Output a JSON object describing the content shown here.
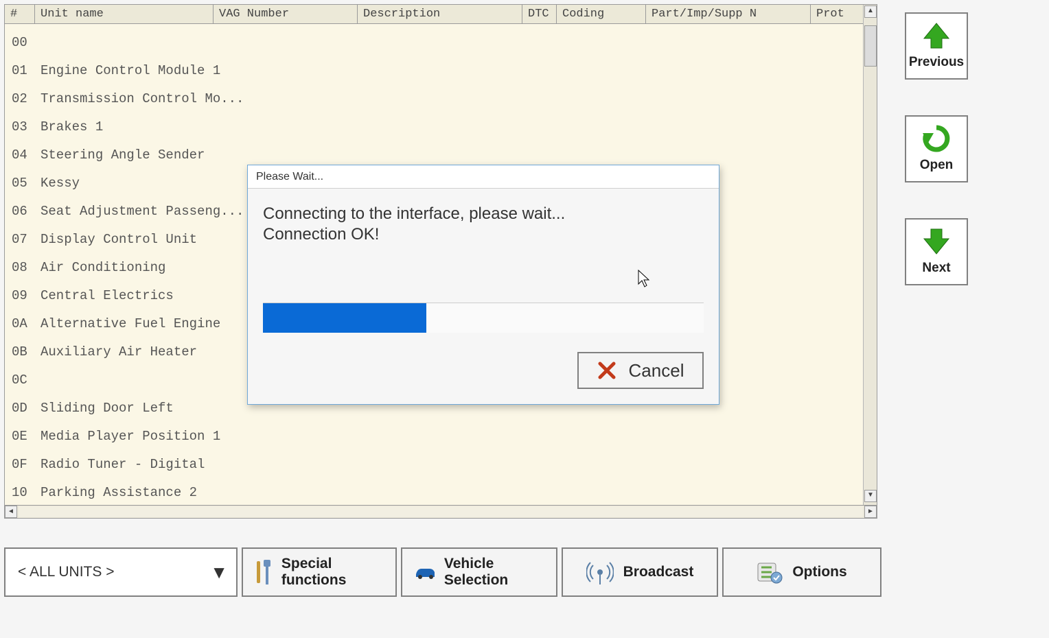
{
  "table": {
    "headers": {
      "num": "#",
      "unit_name": "Unit name",
      "vag_number": "VAG Number",
      "description": "Description",
      "dtc": "DTC",
      "coding": "Coding",
      "part": "Part/Imp/Supp N",
      "prot": "Prot"
    },
    "rows": [
      {
        "id": "00",
        "name": ""
      },
      {
        "id": "01",
        "name": "Engine Control Module 1"
      },
      {
        "id": "02",
        "name": "Transmission Control Mo..."
      },
      {
        "id": "03",
        "name": "Brakes 1"
      },
      {
        "id": "04",
        "name": "Steering Angle Sender"
      },
      {
        "id": "05",
        "name": "Kessy"
      },
      {
        "id": "06",
        "name": "Seat Adjustment Passeng..."
      },
      {
        "id": "07",
        "name": "Display Control Unit"
      },
      {
        "id": "08",
        "name": "Air Conditioning"
      },
      {
        "id": "09",
        "name": "Central Electrics"
      },
      {
        "id": "0A",
        "name": "Alternative Fuel Engine"
      },
      {
        "id": "0B",
        "name": "Auxiliary Air Heater"
      },
      {
        "id": "0C",
        "name": ""
      },
      {
        "id": "0D",
        "name": "Sliding Door Left"
      },
      {
        "id": "0E",
        "name": "Media Player Position 1"
      },
      {
        "id": "0F",
        "name": "Radio Tuner - Digital"
      },
      {
        "id": "10",
        "name": "Parking Assistance 2"
      }
    ]
  },
  "side": {
    "previous": "Previous",
    "open": "Open",
    "next": "Next"
  },
  "filter": {
    "label": "< ALL UNITS >"
  },
  "toolbar": {
    "special_functions": "Special functions",
    "vehicle_selection": "Vehicle Selection",
    "broadcast": "Broadcast",
    "options": "Options"
  },
  "dialog": {
    "title": "Please Wait...",
    "line1": "Connecting to the interface, please wait...",
    "line2": "Connection OK!",
    "progress_percent": 37,
    "cancel": "Cancel"
  },
  "colors": {
    "accent_green": "#34a720",
    "progress_blue": "#0a6ad6",
    "panel_bg": "#fbf7e6"
  }
}
